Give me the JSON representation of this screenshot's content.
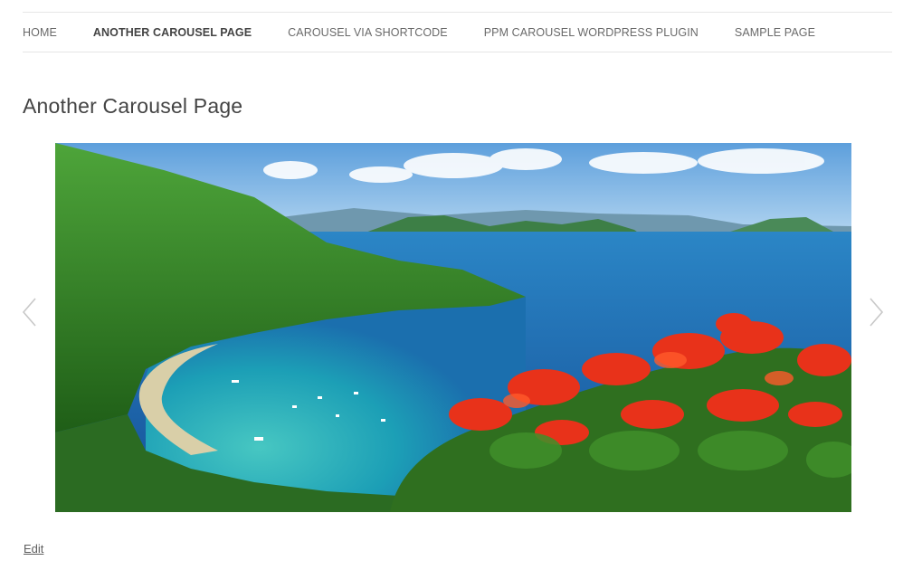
{
  "nav": {
    "items": [
      {
        "label": "HOME",
        "active": false
      },
      {
        "label": "ANOTHER CAROUSEL PAGE",
        "active": true
      },
      {
        "label": "CAROUSEL VIA SHORTCODE",
        "active": false
      },
      {
        "label": "PPM CAROUSEL WORDPRESS PLUGIN",
        "active": false
      },
      {
        "label": "SAMPLE PAGE",
        "active": false
      }
    ]
  },
  "page": {
    "title": "Another Carousel Page",
    "edit_label": "Edit"
  },
  "carousel": {
    "prev_icon": "chevron-left-icon",
    "next_icon": "chevron-right-icon",
    "slide_image": "tropical-bay-landscape-photo"
  },
  "colors": {
    "sky": "#7fb6e8",
    "sea": "#1d6fb0",
    "lagoon": "#2bb0b8",
    "hills": "#3f9a2a",
    "flowers": "#e8321a",
    "arrow": "#c8c8c8"
  }
}
